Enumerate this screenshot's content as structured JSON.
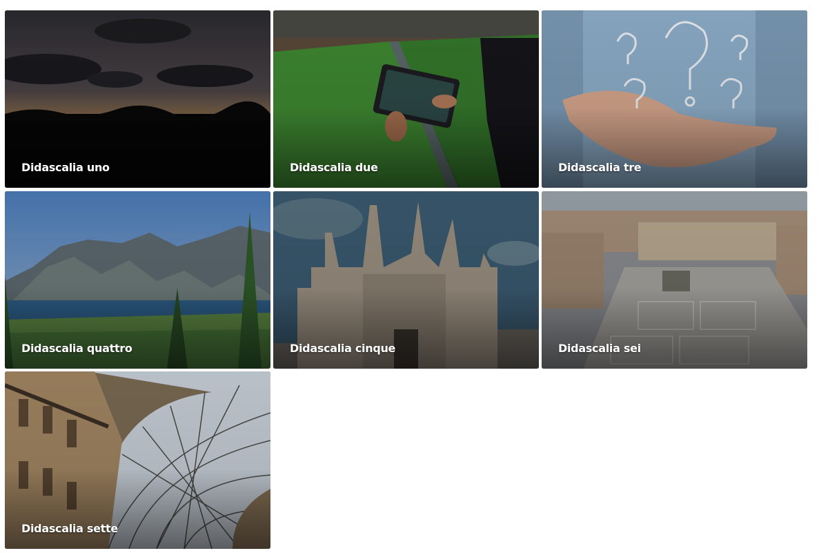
{
  "gallery": {
    "items": [
      {
        "caption": "Didascalia uno",
        "image": "sunset-landscape"
      },
      {
        "caption": "Didascalia due",
        "image": "smart-farming-tablet"
      },
      {
        "caption": "Didascalia tre",
        "image": "hand-question-marks"
      },
      {
        "caption": "Didascalia quattro",
        "image": "lake-mountains"
      },
      {
        "caption": "Didascalia cinque",
        "image": "milan-cathedral"
      },
      {
        "caption": "Didascalia sei",
        "image": "piazza-duomo-aerial"
      },
      {
        "caption": "Didascalia sette",
        "image": "galleria-glass-dome"
      }
    ]
  }
}
